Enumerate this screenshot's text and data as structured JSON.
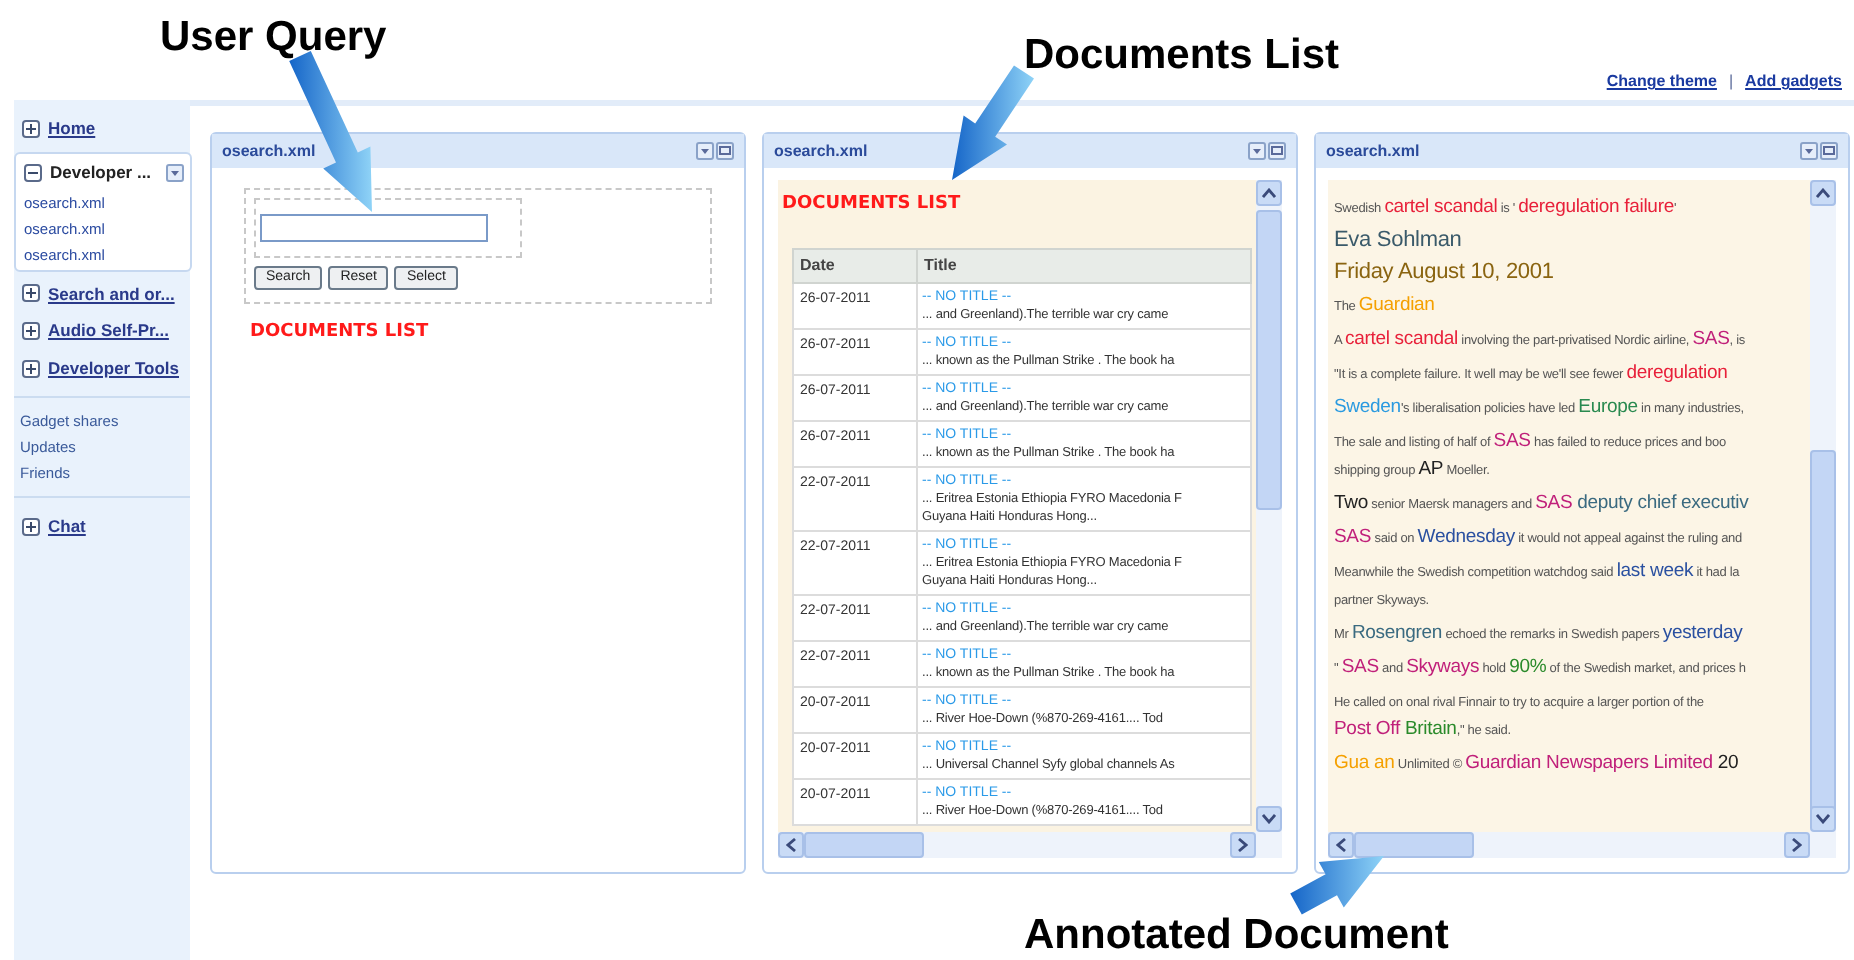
{
  "callouts": [
    {
      "text": "User Query"
    },
    {
      "text": "Documents List"
    },
    {
      "text": "Annotated Document"
    }
  ],
  "top_links": {
    "items": [
      "Change theme",
      "Add gadgets"
    ],
    "separator": "|"
  },
  "sidebar": {
    "sections": [
      {
        "label": "Home",
        "expanded": false
      },
      {
        "label": "Developer ...",
        "expanded": true,
        "children": [
          "osearch.xml",
          "osearch.xml",
          "osearch.xml"
        ]
      },
      {
        "label": "Search and or...",
        "expanded": false
      },
      {
        "label": "Audio Self-Pr...",
        "expanded": false
      },
      {
        "label": "Developer Tools",
        "expanded": false
      }
    ],
    "links": [
      "Gadget shares",
      "Updates",
      "Friends"
    ],
    "footer_sections": [
      {
        "label": "Chat",
        "expanded": false
      }
    ]
  },
  "gadgets": [
    {
      "kind": "query",
      "title": "osearch.xml",
      "buttons": [
        "Search",
        "Reset",
        "Select"
      ],
      "heading": "DOCUMENTS LIST"
    },
    {
      "kind": "list",
      "title": "osearch.xml",
      "heading": "DOCUMENTS LIST",
      "columns": [
        "Date",
        "Title"
      ],
      "rows": [
        {
          "date": "26-07-2011",
          "title": "-- NO TITLE --",
          "snippet": [
            "... and Greenland).The terrible war cry came"
          ]
        },
        {
          "date": "26-07-2011",
          "title": "-- NO TITLE --",
          "snippet": [
            "... known as the Pullman Strike . The book ha"
          ]
        },
        {
          "date": "26-07-2011",
          "title": "-- NO TITLE --",
          "snippet": [
            "... and Greenland).The terrible war cry came"
          ]
        },
        {
          "date": "26-07-2011",
          "title": "-- NO TITLE --",
          "snippet": [
            "... known as the Pullman Strike . The book ha"
          ]
        },
        {
          "date": "22-07-2011",
          "title": "-- NO TITLE --",
          "snippet": [
            "... Eritrea Estonia Ethiopia FYRO Macedonia F",
            "Guyana Haiti Honduras Hong..."
          ]
        },
        {
          "date": "22-07-2011",
          "title": "-- NO TITLE --",
          "snippet": [
            "... Eritrea Estonia Ethiopia FYRO Macedonia F",
            "Guyana Haiti Honduras Hong..."
          ]
        },
        {
          "date": "22-07-2011",
          "title": "-- NO TITLE --",
          "snippet": [
            "... and Greenland).The terrible war cry came"
          ]
        },
        {
          "date": "22-07-2011",
          "title": "-- NO TITLE --",
          "snippet": [
            "... known as the Pullman Strike . The book ha"
          ]
        },
        {
          "date": "20-07-2011",
          "title": "-- NO TITLE --",
          "snippet": [
            "... River Hoe-Down (%870-269-4161.... Tod"
          ]
        },
        {
          "date": "20-07-2011",
          "title": "-- NO TITLE --",
          "snippet": [
            "... Universal Channel Syfy global channels As"
          ]
        },
        {
          "date": "20-07-2011",
          "title": "-- NO TITLE --",
          "snippet": [
            "... River Hoe-Down (%870-269-4161.... Tod"
          ]
        }
      ]
    },
    {
      "kind": "document",
      "title": "osearch.xml",
      "paragraphs": [
        [
          [
            {
              "text": "Swedish "
            },
            {
              "text": "cartel scandal",
              "color": "#e8203a"
            },
            {
              "text": " is ' "
            },
            {
              "text": "deregulation failure",
              "color": "#e8203a"
            },
            {
              "text": "'"
            }
          ]
        ],
        [
          [
            {
              "text": "Eva Sohlman",
              "color": "#3a5a6a",
              "big": true
            }
          ]
        ],
        [
          [
            {
              "text": "Friday August 10, 2001",
              "color": "#8a6410",
              "big": true
            }
          ]
        ],
        [
          [
            {
              "text": "The "
            },
            {
              "text": "Guardian",
              "color": "#f5a000"
            }
          ]
        ],
        [
          [
            {
              "text": "A "
            },
            {
              "text": "cartel scandal",
              "color": "#e8203a"
            },
            {
              "text": " involving the part-privatised Nordic airline, "
            },
            {
              "text": "SAS",
              "color": "#c0207a"
            },
            {
              "text": ", is"
            }
          ]
        ],
        [
          [
            {
              "text": "\"It is a complete failure. It well may be we'll see fewer "
            },
            {
              "text": "deregulation",
              "color": "#e8203a"
            }
          ]
        ],
        [
          [
            {
              "text": "Sweden",
              "color": "#2a9ae0"
            },
            {
              "text": "'s liberalisation policies have led "
            },
            {
              "text": "Europe",
              "color": "#2a8a50"
            },
            {
              "text": " in many industries,"
            }
          ]
        ],
        [
          [
            {
              "text": "The sale and listing of half of "
            },
            {
              "text": "SAS",
              "color": "#c0207a"
            },
            {
              "text": " has failed to reduce prices and boo"
            }
          ],
          [
            {
              "text": "shipping group "
            },
            {
              "text": "AP",
              "color": "#222222"
            },
            {
              "text": " Moeller."
            }
          ]
        ],
        [
          [
            {
              "text": "Two",
              "color": "#222222"
            },
            {
              "text": " senior Maersk managers and "
            },
            {
              "text": "SAS",
              "color": "#c0207a"
            },
            {
              "text": " deputy chief executiv",
              "color": "#3a6a80"
            }
          ]
        ],
        [
          [
            {
              "text": "SAS",
              "color": "#c0207a"
            },
            {
              "text": " said on "
            },
            {
              "text": "Wednesday",
              "color": "#2a50a0"
            },
            {
              "text": " it would not appeal against the ruling and"
            }
          ]
        ],
        [
          [
            {
              "text": "Meanwhile the Swedish competition watchdog said "
            },
            {
              "text": "last week",
              "color": "#2a50a0"
            },
            {
              "text": " it had la"
            }
          ],
          [
            {
              "text": "partner Skyways."
            }
          ]
        ],
        [
          [
            {
              "text": "Mr "
            },
            {
              "text": "Rosengren",
              "color": "#3a6a80"
            },
            {
              "text": " echoed the remarks in Swedish papers "
            },
            {
              "text": "yesterday",
              "color": "#2a50a0"
            }
          ]
        ],
        [
          [
            {
              "text": "\" "
            },
            {
              "text": "SAS",
              "color": "#c0207a"
            },
            {
              "text": " and "
            },
            {
              "text": "Skyways",
              "color": "#c0207a"
            },
            {
              "text": " hold "
            },
            {
              "text": "90%",
              "color": "#2a8a2a"
            },
            {
              "text": " of the Swedish market, and prices h"
            }
          ]
        ],
        [
          [
            {
              "text": "He called on "
            },
            {
              "text": "onal rival Finnair to try to acquire a larger portion of the"
            }
          ],
          [
            {
              "text": "Post Off ",
              "color": "#c0207a"
            },
            {
              "text": "Britain",
              "color": "#2a8a2a"
            },
            {
              "text": ",\" he said."
            }
          ]
        ],
        [
          [
            {
              "text": "Gua ",
              "color": "#f5a000"
            },
            {
              "text": "an",
              "color": "#f5a000"
            },
            {
              "text": " Unlimited © "
            },
            {
              "text": "Guardian Newspapers Limited",
              "color": "#c0207a"
            },
            {
              "text": " 20",
              "color": "#222222"
            }
          ]
        ]
      ]
    }
  ]
}
